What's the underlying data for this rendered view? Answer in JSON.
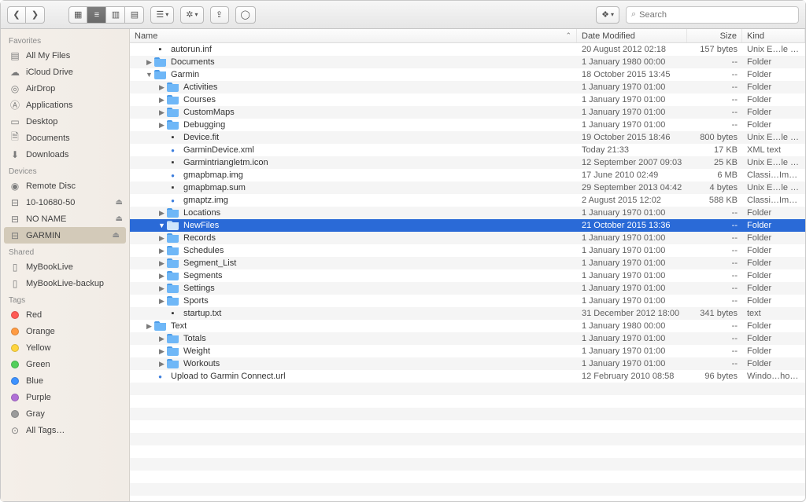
{
  "toolbar": {
    "search_placeholder": "Search"
  },
  "sidebar": {
    "sections": [
      {
        "title": "Favorites",
        "items": [
          {
            "id": "all-my-files",
            "label": "All My Files",
            "icon": "stack"
          },
          {
            "id": "icloud-drive",
            "label": "iCloud Drive",
            "icon": "cloud"
          },
          {
            "id": "airdrop",
            "label": "AirDrop",
            "icon": "airdrop"
          },
          {
            "id": "applications",
            "label": "Applications",
            "icon": "apps"
          },
          {
            "id": "desktop",
            "label": "Desktop",
            "icon": "desktop"
          },
          {
            "id": "documents",
            "label": "Documents",
            "icon": "doc"
          },
          {
            "id": "downloads",
            "label": "Downloads",
            "icon": "downloads"
          }
        ]
      },
      {
        "title": "Devices",
        "items": [
          {
            "id": "remote-disc",
            "label": "Remote Disc",
            "icon": "disc"
          },
          {
            "id": "10-10680-50",
            "label": "10-10680-50",
            "icon": "disk",
            "eject": true
          },
          {
            "id": "no-name",
            "label": "NO NAME",
            "icon": "disk",
            "eject": true
          },
          {
            "id": "garmin",
            "label": "GARMIN",
            "icon": "disk",
            "eject": true,
            "selected": true
          }
        ]
      },
      {
        "title": "Shared",
        "items": [
          {
            "id": "mybooklive",
            "label": "MyBookLive",
            "icon": "server"
          },
          {
            "id": "mybooklive-backup",
            "label": "MyBookLive-backup",
            "icon": "server"
          }
        ]
      },
      {
        "title": "Tags",
        "items": [
          {
            "id": "tag-red",
            "label": "Red",
            "icon": "tag",
            "color": "#ff5b55"
          },
          {
            "id": "tag-orange",
            "label": "Orange",
            "icon": "tag",
            "color": "#ff9b42"
          },
          {
            "id": "tag-yellow",
            "label": "Yellow",
            "icon": "tag",
            "color": "#ffd53e"
          },
          {
            "id": "tag-green",
            "label": "Green",
            "icon": "tag",
            "color": "#53cf5a"
          },
          {
            "id": "tag-blue",
            "label": "Blue",
            "icon": "tag",
            "color": "#3e92ff"
          },
          {
            "id": "tag-purple",
            "label": "Purple",
            "icon": "tag",
            "color": "#b06fd6"
          },
          {
            "id": "tag-gray",
            "label": "Gray",
            "icon": "tag",
            "color": "#9b9b9b"
          },
          {
            "id": "all-tags",
            "label": "All Tags…",
            "icon": "alltags"
          }
        ]
      }
    ]
  },
  "columns": {
    "name": "Name",
    "date": "Date Modified",
    "size": "Size",
    "kind": "Kind"
  },
  "rows": [
    {
      "indent": 0,
      "disclosure": "",
      "icon": "doc",
      "name": "autorun.inf",
      "date": "20 August 2012 02:18",
      "size": "157 bytes",
      "kind": "Unix E…le File"
    },
    {
      "indent": 0,
      "disclosure": "closed",
      "icon": "folder",
      "name": "Documents",
      "date": "1 January 1980 00:00",
      "size": "--",
      "kind": "Folder"
    },
    {
      "indent": 0,
      "disclosure": "open",
      "icon": "folder",
      "name": "Garmin",
      "date": "18 October 2015 13:45",
      "size": "--",
      "kind": "Folder"
    },
    {
      "indent": 1,
      "disclosure": "closed",
      "icon": "folder",
      "name": "Activities",
      "date": "1 January 1970 01:00",
      "size": "--",
      "kind": "Folder"
    },
    {
      "indent": 1,
      "disclosure": "closed",
      "icon": "folder",
      "name": "Courses",
      "date": "1 January 1970 01:00",
      "size": "--",
      "kind": "Folder"
    },
    {
      "indent": 1,
      "disclosure": "closed",
      "icon": "folder",
      "name": "CustomMaps",
      "date": "1 January 1970 01:00",
      "size": "--",
      "kind": "Folder"
    },
    {
      "indent": 1,
      "disclosure": "closed",
      "icon": "folder",
      "name": "Debugging",
      "date": "1 January 1970 01:00",
      "size": "--",
      "kind": "Folder"
    },
    {
      "indent": 1,
      "disclosure": "",
      "icon": "doc",
      "name": "Device.fit",
      "date": "19 October 2015 18:46",
      "size": "800 bytes",
      "kind": "Unix E…le File"
    },
    {
      "indent": 1,
      "disclosure": "",
      "icon": "dot",
      "name": "GarminDevice.xml",
      "date": "Today 21:33",
      "size": "17 KB",
      "kind": "XML text"
    },
    {
      "indent": 1,
      "disclosure": "",
      "icon": "doc",
      "name": "Garmintriangletm.icon",
      "date": "12 September 2007 09:03",
      "size": "25 KB",
      "kind": "Unix E…le File"
    },
    {
      "indent": 1,
      "disclosure": "",
      "icon": "dot",
      "name": "gmapbmap.img",
      "date": "17 June 2010 02:49",
      "size": "6 MB",
      "kind": "Classi…Image"
    },
    {
      "indent": 1,
      "disclosure": "",
      "icon": "doc",
      "name": "gmapbmap.sum",
      "date": "29 September 2013 04:42",
      "size": "4 bytes",
      "kind": "Unix E…le File"
    },
    {
      "indent": 1,
      "disclosure": "",
      "icon": "dot",
      "name": "gmaptz.img",
      "date": "2 August 2015 12:02",
      "size": "588 KB",
      "kind": "Classi…Image"
    },
    {
      "indent": 1,
      "disclosure": "closed",
      "icon": "folder",
      "name": "Locations",
      "date": "1 January 1970 01:00",
      "size": "--",
      "kind": "Folder"
    },
    {
      "indent": 1,
      "disclosure": "open",
      "icon": "folder",
      "name": "NewFiles",
      "date": "21 October 2015 13:36",
      "size": "--",
      "kind": "Folder",
      "selected": true
    },
    {
      "indent": 1,
      "disclosure": "closed",
      "icon": "folder",
      "name": "Records",
      "date": "1 January 1970 01:00",
      "size": "--",
      "kind": "Folder"
    },
    {
      "indent": 1,
      "disclosure": "closed",
      "icon": "folder",
      "name": "Schedules",
      "date": "1 January 1970 01:00",
      "size": "--",
      "kind": "Folder"
    },
    {
      "indent": 1,
      "disclosure": "closed",
      "icon": "folder",
      "name": "Segment_List",
      "date": "1 January 1970 01:00",
      "size": "--",
      "kind": "Folder"
    },
    {
      "indent": 1,
      "disclosure": "closed",
      "icon": "folder",
      "name": "Segments",
      "date": "1 January 1970 01:00",
      "size": "--",
      "kind": "Folder"
    },
    {
      "indent": 1,
      "disclosure": "closed",
      "icon": "folder",
      "name": "Settings",
      "date": "1 January 1970 01:00",
      "size": "--",
      "kind": "Folder"
    },
    {
      "indent": 1,
      "disclosure": "closed",
      "icon": "folder",
      "name": "Sports",
      "date": "1 January 1970 01:00",
      "size": "--",
      "kind": "Folder"
    },
    {
      "indent": 1,
      "disclosure": "",
      "icon": "doc",
      "name": "startup.txt",
      "date": "31 December 2012 18:00",
      "size": "341 bytes",
      "kind": "text"
    },
    {
      "indent": 0,
      "disclosure": "closed",
      "icon": "folder",
      "name": "Text",
      "date": "1 January 1980 00:00",
      "size": "--",
      "kind": "Folder"
    },
    {
      "indent": 1,
      "disclosure": "closed",
      "icon": "folder",
      "name": "Totals",
      "date": "1 January 1970 01:00",
      "size": "--",
      "kind": "Folder"
    },
    {
      "indent": 1,
      "disclosure": "closed",
      "icon": "folder",
      "name": "Weight",
      "date": "1 January 1970 01:00",
      "size": "--",
      "kind": "Folder"
    },
    {
      "indent": 1,
      "disclosure": "closed",
      "icon": "folder",
      "name": "Workouts",
      "date": "1 January 1970 01:00",
      "size": "--",
      "kind": "Folder"
    },
    {
      "indent": 0,
      "disclosure": "",
      "icon": "dot",
      "name": "Upload to Garmin Connect.url",
      "date": "12 February 2010 08:58",
      "size": "96 bytes",
      "kind": "Windo…hortcut"
    }
  ],
  "empty_row_count": 10
}
